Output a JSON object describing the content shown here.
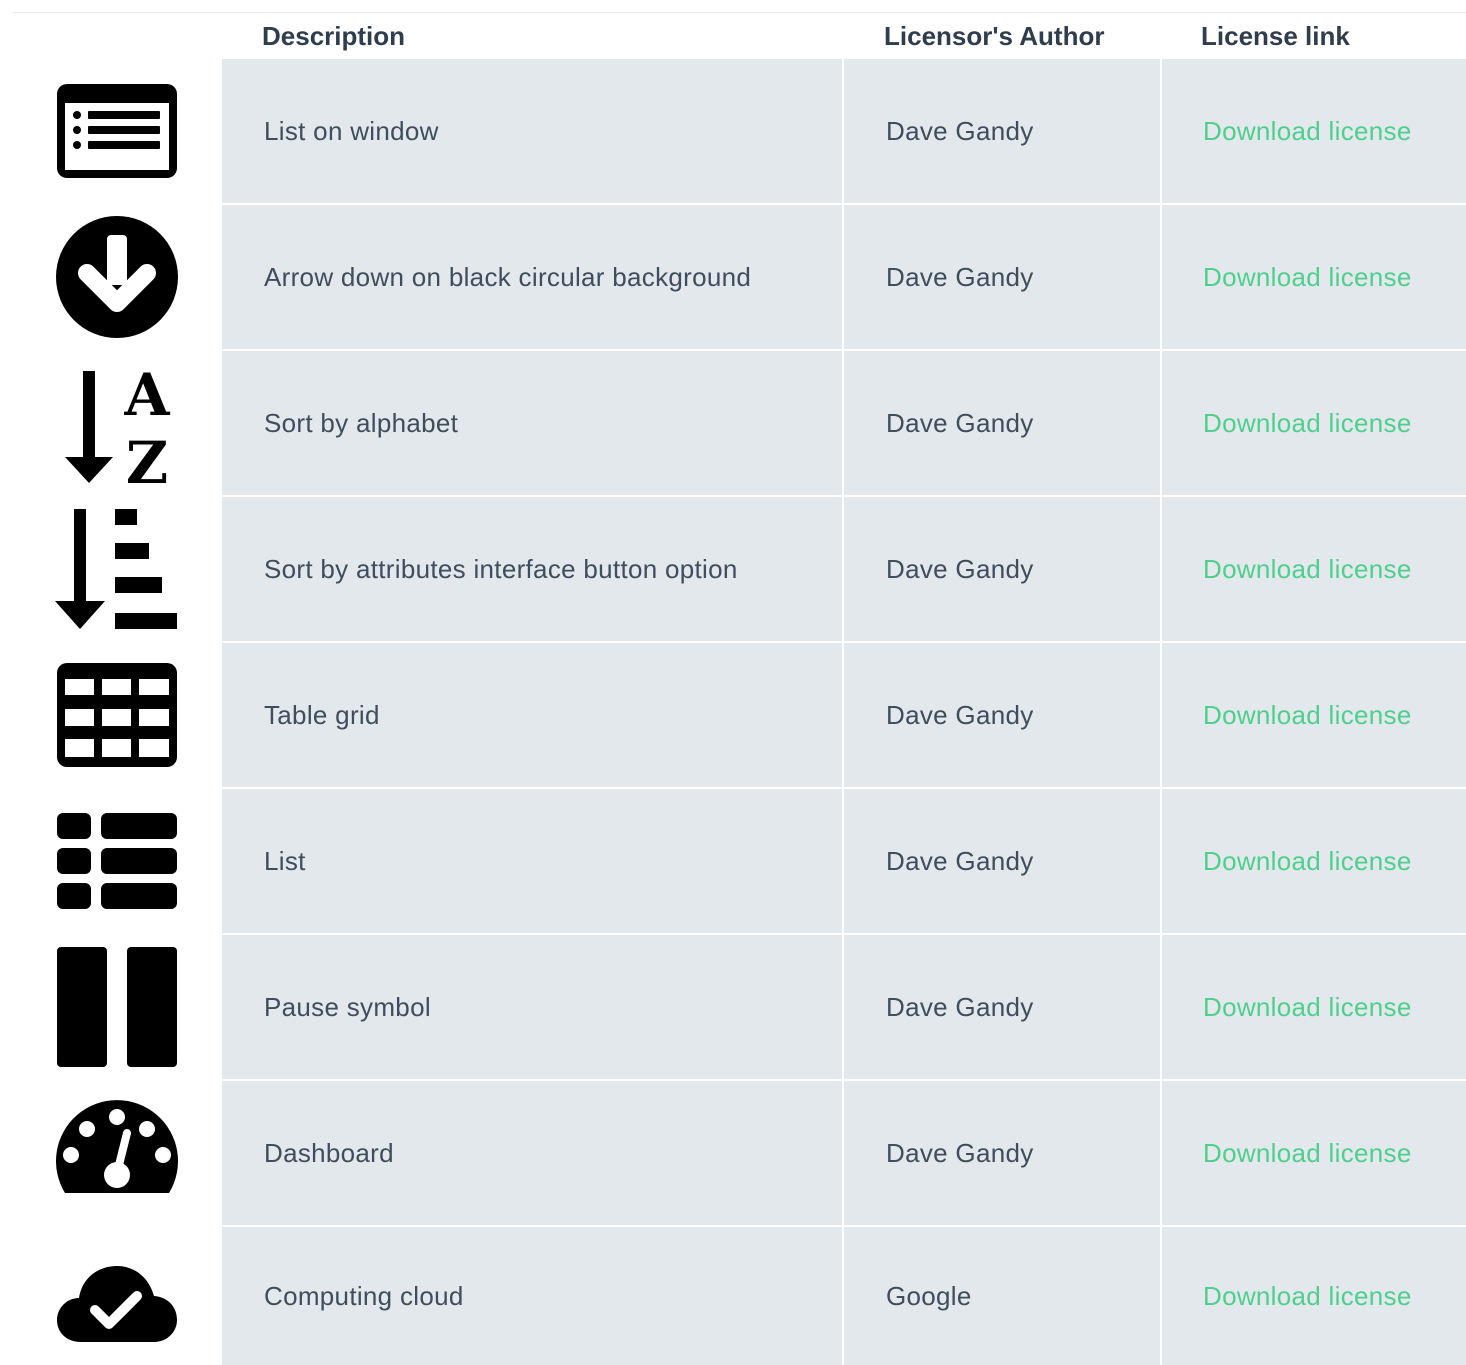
{
  "header": {
    "description": "Description",
    "author": "Licensor's Author",
    "license_link": "License link"
  },
  "rows": [
    {
      "icon": "list-window-icon",
      "description": "List on window",
      "author": "Dave Gandy",
      "link": "Download license"
    },
    {
      "icon": "arrow-down-circle-icon",
      "description": "Arrow down on black circular background",
      "author": "Dave Gandy",
      "link": "Download license"
    },
    {
      "icon": "sort-alpha-icon",
      "description": "Sort by alphabet",
      "author": "Dave Gandy",
      "link": "Download license"
    },
    {
      "icon": "sort-attributes-icon",
      "description": "Sort by attributes interface button option",
      "author": "Dave Gandy",
      "link": "Download license"
    },
    {
      "icon": "table-grid-icon",
      "description": "Table grid",
      "author": "Dave Gandy",
      "link": "Download license"
    },
    {
      "icon": "list-icon",
      "description": "List",
      "author": "Dave Gandy",
      "link": "Download license"
    },
    {
      "icon": "pause-icon",
      "description": "Pause symbol",
      "author": "Dave Gandy",
      "link": "Download license"
    },
    {
      "icon": "dashboard-icon",
      "description": "Dashboard",
      "author": "Dave Gandy",
      "link": "Download license"
    },
    {
      "icon": "cloud-check-icon",
      "description": "Computing cloud",
      "author": "Google",
      "link": "Download license"
    }
  ],
  "colors": {
    "row_bg": "#e3e8ec",
    "text": "#3f4d5c",
    "header_text": "#2f3d4c",
    "link": "#4fcf8d"
  }
}
